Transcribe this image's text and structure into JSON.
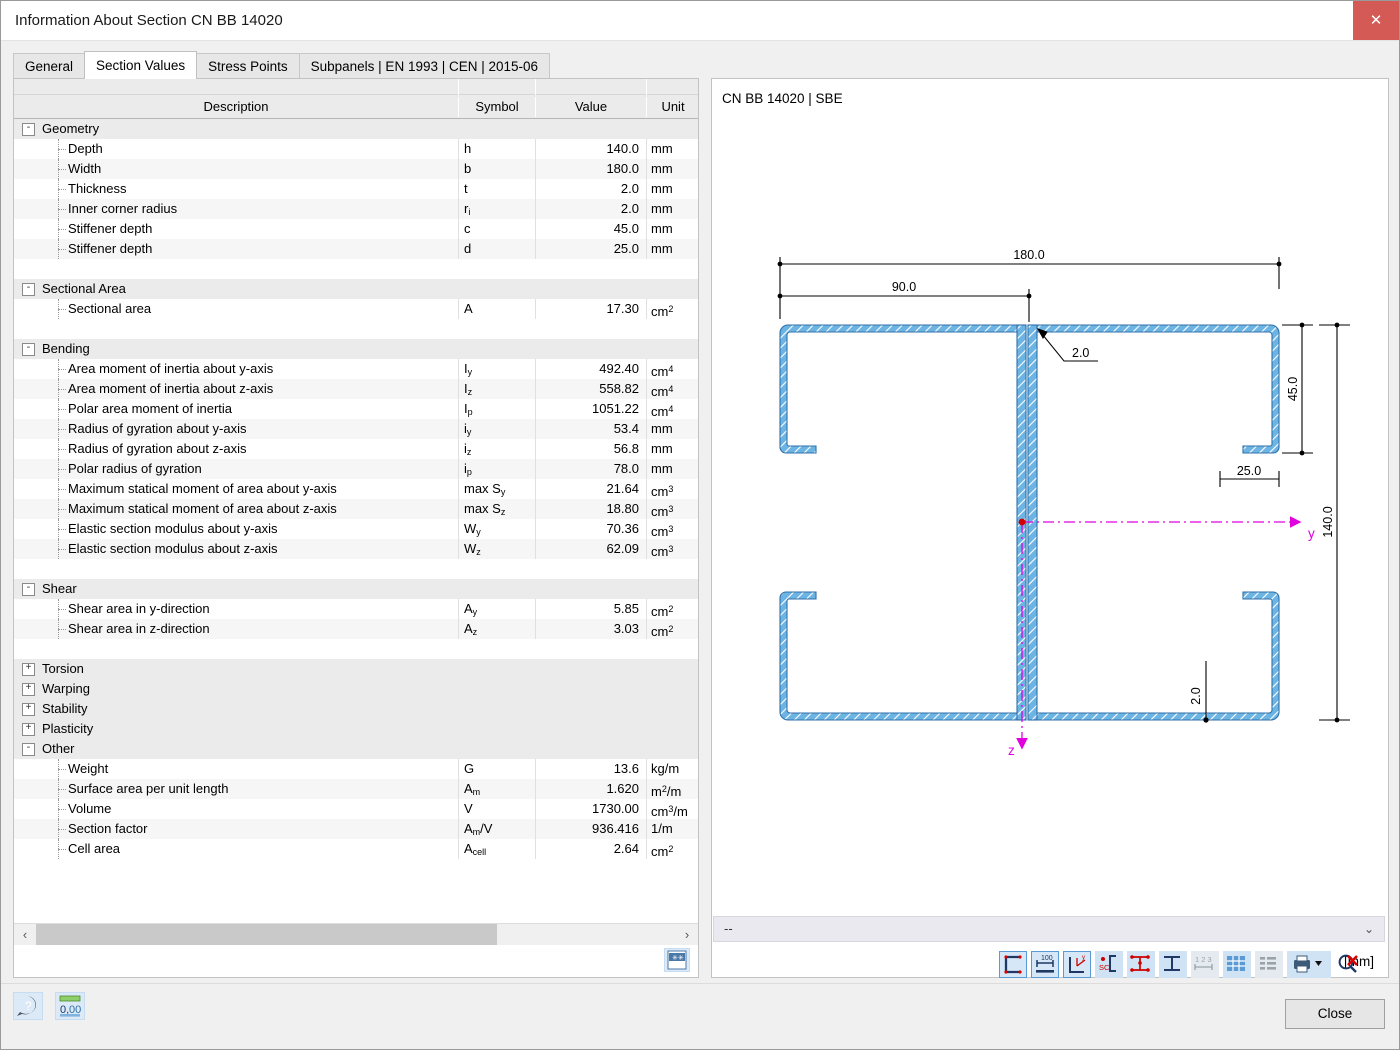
{
  "window": {
    "title": "Information About Section CN BB 14020",
    "close_icon": "close-x-icon"
  },
  "tabs": [
    {
      "label": "General",
      "active": false
    },
    {
      "label": "Section Values",
      "active": true
    },
    {
      "label": "Stress Points",
      "active": false
    },
    {
      "label": "Subpanels | EN 1993 | CEN | 2015-06",
      "active": false
    }
  ],
  "table": {
    "columns": [
      "Description",
      "Symbol",
      "Value",
      "Unit"
    ],
    "groups": [
      {
        "name": "Geometry",
        "expanded": true,
        "toggle": "-",
        "rows": [
          {
            "desc": "Depth",
            "sym": "h",
            "sym_sub": "",
            "val": "140.0",
            "unit": "mm",
            "unit_sup": ""
          },
          {
            "desc": "Width",
            "sym": "b",
            "sym_sub": "",
            "val": "180.0",
            "unit": "mm",
            "unit_sup": ""
          },
          {
            "desc": "Thickness",
            "sym": "t",
            "sym_sub": "",
            "val": "2.0",
            "unit": "mm",
            "unit_sup": ""
          },
          {
            "desc": "Inner corner radius",
            "sym": "r",
            "sym_sub": "i",
            "val": "2.0",
            "unit": "mm",
            "unit_sup": ""
          },
          {
            "desc": "Stiffener depth",
            "sym": "c",
            "sym_sub": "",
            "val": "45.0",
            "unit": "mm",
            "unit_sup": ""
          },
          {
            "desc": "Stiffener depth",
            "sym": "d",
            "sym_sub": "",
            "val": "25.0",
            "unit": "mm",
            "unit_sup": ""
          }
        ]
      },
      {
        "name": "Sectional Area",
        "expanded": true,
        "toggle": "-",
        "rows": [
          {
            "desc": "Sectional area",
            "sym": "A",
            "sym_sub": "",
            "val": "17.30",
            "unit": "cm",
            "unit_sup": "2"
          }
        ]
      },
      {
        "name": "Bending",
        "expanded": true,
        "toggle": "-",
        "rows": [
          {
            "desc": "Area moment of inertia about y-axis",
            "sym": "I",
            "sym_sub": "y",
            "val": "492.40",
            "unit": "cm",
            "unit_sup": "4"
          },
          {
            "desc": "Area moment of inertia about z-axis",
            "sym": "I",
            "sym_sub": "z",
            "val": "558.82",
            "unit": "cm",
            "unit_sup": "4"
          },
          {
            "desc": "Polar area moment of inertia",
            "sym": "I",
            "sym_sub": "p",
            "val": "1051.22",
            "unit": "cm",
            "unit_sup": "4"
          },
          {
            "desc": "Radius of gyration about y-axis",
            "sym": "i",
            "sym_sub": "y",
            "val": "53.4",
            "unit": "mm",
            "unit_sup": ""
          },
          {
            "desc": "Radius of gyration about z-axis",
            "sym": "i",
            "sym_sub": "z",
            "val": "56.8",
            "unit": "mm",
            "unit_sup": ""
          },
          {
            "desc": "Polar radius of gyration",
            "sym": "i",
            "sym_sub": "p",
            "val": "78.0",
            "unit": "mm",
            "unit_sup": ""
          },
          {
            "desc": "Maximum statical moment of area about y-axis",
            "sym": "max S",
            "sym_sub": "y",
            "val": "21.64",
            "unit": "cm",
            "unit_sup": "3"
          },
          {
            "desc": "Maximum statical moment of area about z-axis",
            "sym": "max S",
            "sym_sub": "z",
            "val": "18.80",
            "unit": "cm",
            "unit_sup": "3"
          },
          {
            "desc": "Elastic section modulus about y-axis",
            "sym": "W",
            "sym_sub": "y",
            "val": "70.36",
            "unit": "cm",
            "unit_sup": "3"
          },
          {
            "desc": "Elastic section modulus about z-axis",
            "sym": "W",
            "sym_sub": "z",
            "val": "62.09",
            "unit": "cm",
            "unit_sup": "3"
          }
        ]
      },
      {
        "name": "Shear",
        "expanded": true,
        "toggle": "-",
        "rows": [
          {
            "desc": "Shear area in y-direction",
            "sym": "A",
            "sym_sub": "y",
            "val": "5.85",
            "unit": "cm",
            "unit_sup": "2"
          },
          {
            "desc": "Shear area in z-direction",
            "sym": "A",
            "sym_sub": "z",
            "val": "3.03",
            "unit": "cm",
            "unit_sup": "2"
          }
        ]
      },
      {
        "name": "Torsion",
        "expanded": false,
        "toggle": "+",
        "rows": []
      },
      {
        "name": "Warping",
        "expanded": false,
        "toggle": "+",
        "rows": []
      },
      {
        "name": "Stability",
        "expanded": false,
        "toggle": "+",
        "rows": []
      },
      {
        "name": "Plasticity",
        "expanded": false,
        "toggle": "+",
        "rows": []
      },
      {
        "name": "Other",
        "expanded": true,
        "toggle": "-",
        "rows": [
          {
            "desc": "Weight",
            "sym": "G",
            "sym_sub": "",
            "val": "13.6",
            "unit": "kg/m",
            "unit_sup": ""
          },
          {
            "desc": "Surface area per unit length",
            "sym": "A",
            "sym_sub": "m",
            "val": "1.620",
            "unit": "m|/m",
            "unit_sup": "2"
          },
          {
            "desc": "Volume",
            "sym": "V",
            "sym_sub": "",
            "val": "1730.00",
            "unit": "cm|/m",
            "unit_sup": "3"
          },
          {
            "desc": "Section factor",
            "sym": "A",
            "sym_sub": "m",
            "sym_tail": "/V",
            "val": "936.416",
            "unit": "1/m",
            "unit_sup": ""
          },
          {
            "desc": "Cell area",
            "sym": "A",
            "sym_sub": "cell",
            "val": "2.64",
            "unit": "cm",
            "unit_sup": "2"
          }
        ]
      }
    ],
    "scrollbar": {
      "left_arrow": "chevron-left-icon",
      "right_arrow": "chevron-right-icon"
    },
    "export_icon": "export-table-icon"
  },
  "drawing": {
    "title": "CN BB 14020 | SBE",
    "unit_label": "[mm]",
    "dimensions": {
      "width_total": "180.0",
      "width_half": "90.0",
      "thickness_leader": "2.0",
      "stiffener_c": "45.0",
      "stiffener_d": "25.0",
      "thickness_bottom": "2.0",
      "depth_total": "140.0"
    },
    "axes": {
      "y_label": "y",
      "z_label": "z"
    },
    "colors": {
      "profile_fill": "#6cb4e4",
      "profile_edge": "#2f6fa8",
      "axis": "#e000e0",
      "centroid": "#d00000"
    }
  },
  "combo": {
    "value": "--",
    "arrow_icon": "chevron-down-icon"
  },
  "toolbar": [
    {
      "name": "show-section-shape",
      "state": "active"
    },
    {
      "name": "show-dimensions",
      "state": "active"
    },
    {
      "name": "show-axes",
      "state": "active"
    },
    {
      "name": "show-shear-center",
      "state": "normal"
    },
    {
      "name": "show-stress-points",
      "state": "normal"
    },
    {
      "name": "show-parts",
      "state": "normal"
    },
    {
      "name": "show-numbering",
      "state": "dim"
    },
    {
      "name": "show-grid",
      "state": "normal"
    },
    {
      "name": "show-table",
      "state": "dim"
    },
    {
      "name": "print-dropdown",
      "state": "normal"
    },
    {
      "name": "zoom-reset",
      "state": "normal"
    }
  ],
  "footer": {
    "help_icon": "help-icon",
    "decimals_icon": "decimal-places-icon",
    "close_label": "Close"
  }
}
